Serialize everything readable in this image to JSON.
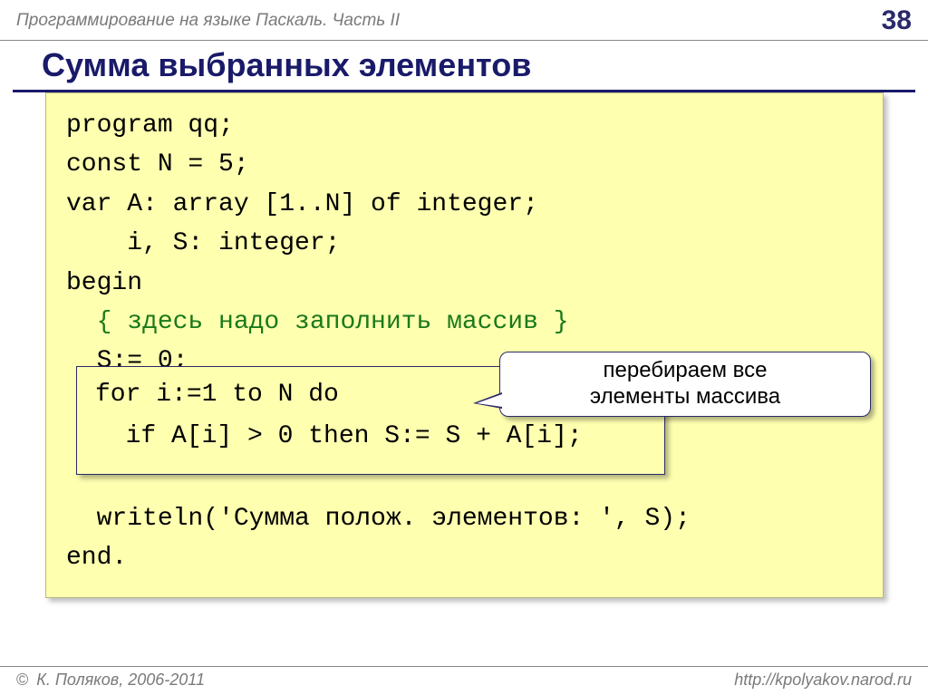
{
  "header": {
    "title": "Программирование на языке Паскаль. Часть II",
    "page_number": "38"
  },
  "slide": {
    "title": "Сумма выбранных элементов"
  },
  "code": {
    "line1": "program qq;",
    "line2": "const N = 5;",
    "line3": "var A: array [1..N] of integer;",
    "line4": "    i, S: integer;",
    "line5": "begin",
    "comment": "  { здесь надо заполнить массив }",
    "line7": "  S:= 0;",
    "line10": "  writeln('Сумма полож. элементов: ', S);",
    "line11": "end."
  },
  "highlight": {
    "line8": "for i:=1 to N do",
    "line9": "  if A[i] > 0 then S:= S + A[i];"
  },
  "callout": {
    "text": "перебираем все\nэлементы массива"
  },
  "footer": {
    "copyright_symbol": "©",
    "copyright": " К. Поляков, 2006-2011",
    "url": "http://kpolyakov.narod.ru"
  }
}
